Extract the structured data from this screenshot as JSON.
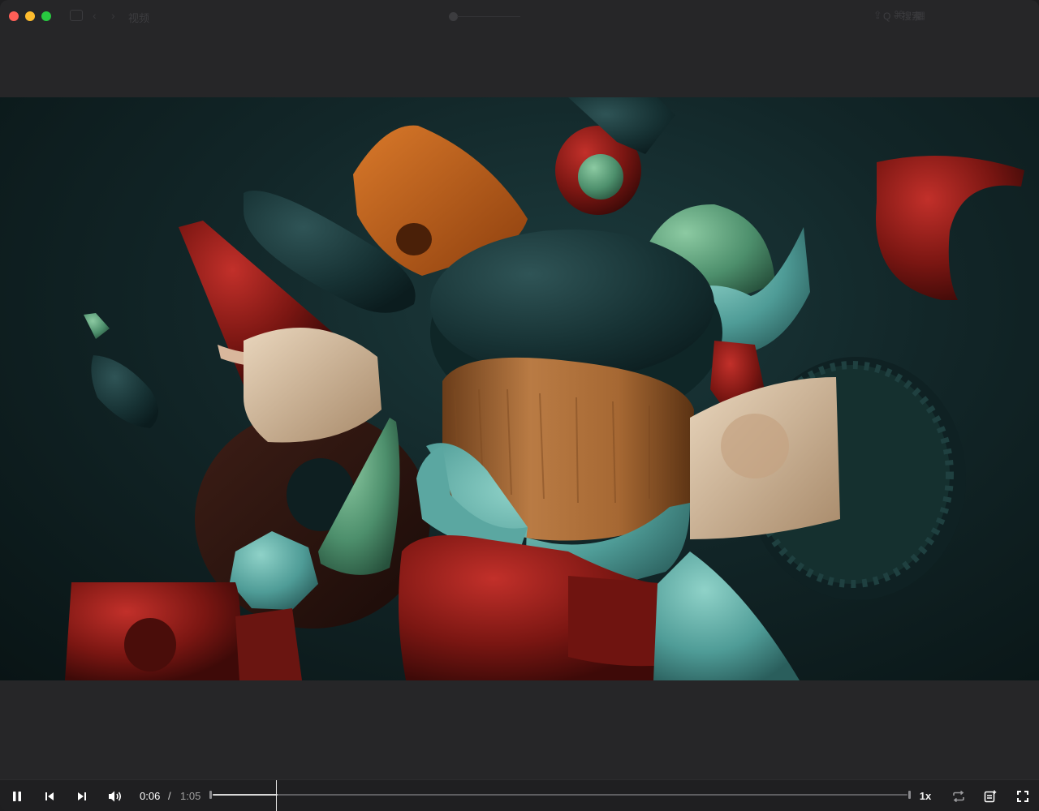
{
  "window": {
    "title": "视频"
  },
  "titlebar": {
    "search_label": "Q ~ 搜索"
  },
  "player": {
    "current_time": "0:06",
    "separator": "/",
    "total_time": "1:05",
    "progress": 0.093,
    "speed_label": "1x",
    "state": "playing"
  },
  "colors": {
    "background": "#262628",
    "control_bar": "#1f1f21",
    "traffic_red": "#fe5f57",
    "traffic_yellow": "#febc2e",
    "traffic_green": "#28c840"
  },
  "icons": {
    "play_pause": "pause-icon",
    "previous": "skip-back-icon",
    "next": "skip-forward-icon",
    "volume": "speaker-icon",
    "loop": "repeat-icon",
    "playlist": "playlist-add-icon",
    "fullscreen": "fullscreen-icon"
  }
}
